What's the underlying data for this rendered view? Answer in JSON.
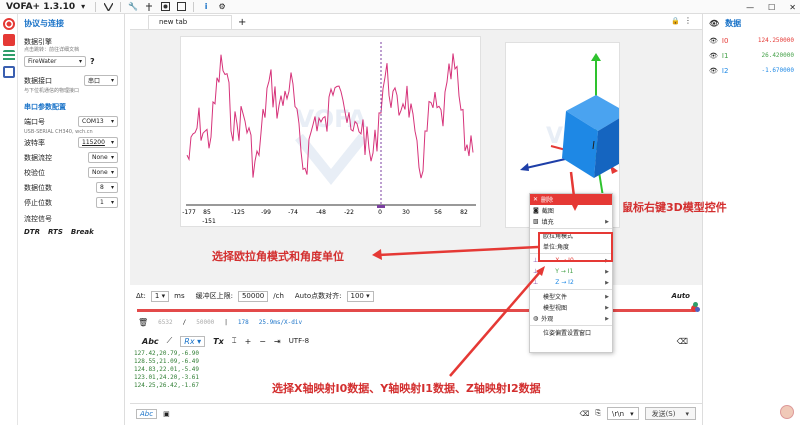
{
  "titlebar": {
    "title": "VOFA+ 1.3.10",
    "window_buttons": [
      "—",
      "☐",
      "✕"
    ]
  },
  "sidebar": {
    "header": "协议与连接",
    "engine_label": "数据引擎",
    "engine_hint": "点击跳转：前往详细文档",
    "engine_value": "FireWater",
    "interface_label": "数据接口",
    "interface_value": "串口",
    "interface_hint": "与下位机通信的物理接口",
    "section_serial": "串口参数配置",
    "port_label": "端口号",
    "port_value": "COM13",
    "port_desc": "USB-SERIAL CH340, wch.cn",
    "baud_label": "波特率",
    "baud_value": "115200",
    "flow_label": "数据流控",
    "flow_value": "None",
    "parity_label": "校验位",
    "parity_value": "None",
    "databits_label": "数据位数",
    "databits_value": "8",
    "stopbits_label": "停止位数",
    "stopbits_value": "1",
    "signals_label": "流控信号",
    "signals": [
      "DTR",
      "RTS",
      "Break"
    ]
  },
  "tabs": {
    "active": "new tab",
    "add": "+"
  },
  "waveform": {
    "x_ticks": [
      "-177",
      "85",
      "-151",
      "-125",
      "-99",
      "-74",
      "-48",
      "-22",
      "0",
      "30",
      "56",
      "82"
    ],
    "line_color": "#d6337a"
  },
  "data_panel": {
    "title": "数据",
    "channels": [
      {
        "name": "I0",
        "value": "124.250000",
        "color": "#e53935"
      },
      {
        "name": "I1",
        "value": "26.420000",
        "color": "#43a047"
      },
      {
        "name": "I2",
        "value": "-1.670000",
        "color": "#1e88e5"
      }
    ]
  },
  "controls": {
    "dt_label": "Δt:",
    "dt_value": "1",
    "dt_unit": "ms",
    "buffer_label": "缓冲区上限:",
    "buffer_value": "50000",
    "buffer_unit": "/ch",
    "auto_align_label": "Auto点数对齐:",
    "auto_align_value": "100",
    "auto_label": "Auto"
  },
  "counts": {
    "count_a": "6532",
    "slash": "/",
    "count_b": "50000",
    "divider": "|",
    "count_c": "178",
    "rate": "25.9ms/X-div"
  },
  "toolbar2": {
    "abc": "Abc",
    "rx": "Rx",
    "tx": "Tx",
    "encoding": "UTF-8"
  },
  "console_lines": [
    "127.42,20.79,-6.90",
    "128.55,21.09,-6.49",
    "124.83,22.01,-5.49",
    "123.01,24.20,-3.61",
    "124.25,26.42,-1.67"
  ],
  "bottombar": {
    "abc": "Abc",
    "newline": "\\r\\n",
    "send": "发送(S)"
  },
  "context_menu": {
    "delete": "删除",
    "screenshot": "截图",
    "fill": "填充",
    "euler": "欧拉角模式",
    "unit": "单位:角度",
    "x_map": "X → I0",
    "y_map": "Y → I1",
    "z_map": "Z → I2",
    "model_file": "模型文件",
    "model_view": "模型视图",
    "appearance": "外观",
    "reset_pose": "位姿偏置设置窗口"
  },
  "annotations": {
    "right_click": "鼠标右键3D模型控件",
    "euler_hint": "选择欧拉角模式和角度单位",
    "mapping_hint": "选择X轴映射I0数据、Y轴映射I1数据、Z轴映射I2数据"
  },
  "colors": {
    "accent": "#1a73c8",
    "annotation": "#d32f2f",
    "cube": "#1e88e5"
  }
}
